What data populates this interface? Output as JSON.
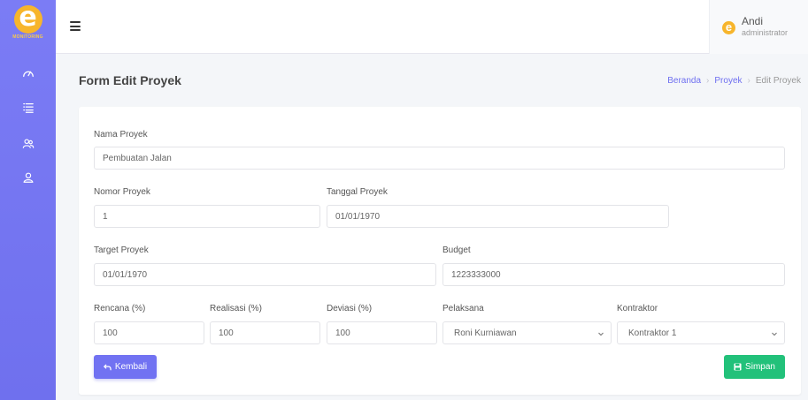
{
  "app": {
    "logo_text": "MONITORING",
    "logo_letter": "e"
  },
  "user": {
    "name": "Andi",
    "role": "administrator"
  },
  "page": {
    "title": "Form Edit Proyek"
  },
  "breadcrumb": [
    "Beranda",
    "Proyek",
    "Edit Proyek"
  ],
  "form": {
    "nama_label": "Nama Proyek",
    "nama_value": "Pembuatan Jalan",
    "nomor_label": "Nomor Proyek",
    "nomor_value": "1",
    "tanggal_label": "Tanggal Proyek",
    "tanggal_value": "01/01/1970",
    "target_label": "Target Proyek",
    "target_value": "01/01/1970",
    "budget_label": "Budget",
    "budget_value": "1223333000",
    "rencana_label": "Rencana (%)",
    "rencana_value": "100",
    "realisasi_label": "Realisasi (%)",
    "realisasi_value": "100",
    "deviasi_label": "Deviasi (%)",
    "deviasi_value": "100",
    "pelaksana_label": "Pelaksana",
    "pelaksana_value": "Roni Kurniawan",
    "kontraktor_label": "Kontraktor",
    "kontraktor_value": "Kontraktor 1"
  },
  "buttons": {
    "back": "Kembali",
    "save": "Simpan"
  },
  "sidebar_icons": [
    "dashboard-gauge-icon",
    "list-icon",
    "users-icon",
    "user-icon"
  ],
  "colors": {
    "primary": "#7172f2",
    "success": "#22c17a",
    "logo": "#f7b52c"
  }
}
